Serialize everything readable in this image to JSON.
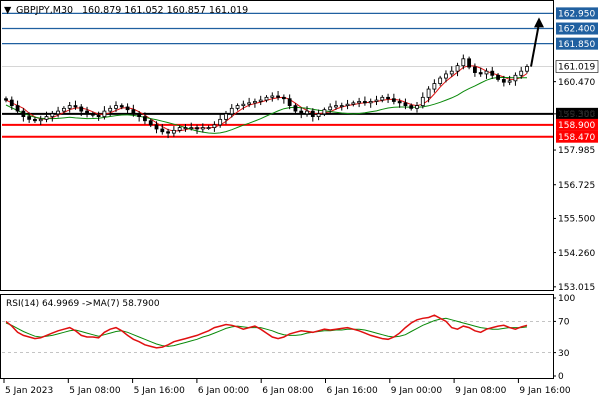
{
  "header": {
    "symbol_tf": "GBPJPY,M30",
    "ohlc": "160.879 161.052 160.857 161.019"
  },
  "rsi_header": "RSI(14) 64.9969  ->MA(7) 58.7900",
  "colors": {
    "candle": "#000000",
    "ma_red": "#e01010",
    "ma_green": "#0a8a0a",
    "level_blue": "#2060a0",
    "level_black": "#000000",
    "level_red": "#ff0000",
    "rsi_line": "#e01010",
    "rsi_ma": "#0a8a0a",
    "arrow": "#000000"
  },
  "chart_data": [
    {
      "type": "candlestick",
      "title": "GBPJPY,M30",
      "y_range": [
        152.9,
        163.4
      ],
      "y_ticks": [
        "160.470",
        "159.300",
        "157.985",
        "156.725",
        "155.500",
        "154.260",
        "153.015"
      ],
      "x_ticks": [
        "5 Jan 2023",
        "5 Jan 08:00",
        "5 Jan 16:00",
        "6 Jan 00:00",
        "6 Jan 08:00",
        "6 Jan 16:00",
        "9 Jan 00:00",
        "9 Jan 08:00",
        "9 Jan 16:00"
      ],
      "current_price": "161.019",
      "levels": [
        {
          "label": "162.950",
          "value": 162.95,
          "color": "blue"
        },
        {
          "label": "162.400",
          "value": 162.4,
          "color": "blue"
        },
        {
          "label": "161.850",
          "value": 161.85,
          "color": "blue"
        },
        {
          "label": "159.300",
          "value": 159.3,
          "color": "black"
        },
        {
          "label": "158.900",
          "value": 158.9,
          "color": "red"
        },
        {
          "label": "158.470",
          "value": 158.47,
          "color": "red"
        }
      ],
      "close_series": [
        159.8,
        159.6,
        159.4,
        159.2,
        159.1,
        159.05,
        159.1,
        159.2,
        159.3,
        159.4,
        159.5,
        159.6,
        159.55,
        159.4,
        159.3,
        159.25,
        159.2,
        159.4,
        159.5,
        159.6,
        159.55,
        159.45,
        159.3,
        159.2,
        159.05,
        158.9,
        158.75,
        158.65,
        158.6,
        158.7,
        158.8,
        158.8,
        158.8,
        158.75,
        158.8,
        158.8,
        158.9,
        159.1,
        159.3,
        159.5,
        159.6,
        159.65,
        159.7,
        159.75,
        159.8,
        159.9,
        159.95,
        159.9,
        159.85,
        159.6,
        159.4,
        159.3,
        159.4,
        159.2,
        159.3,
        159.45,
        159.55,
        159.6,
        159.6,
        159.65,
        159.7,
        159.75,
        159.7,
        159.75,
        159.8,
        159.9,
        159.85,
        159.75,
        159.7,
        159.6,
        159.5,
        159.6,
        159.9,
        160.2,
        160.4,
        160.6,
        160.75,
        160.85,
        161.05,
        161.3,
        161.0,
        160.8,
        160.75,
        160.85,
        160.7,
        160.55,
        160.45,
        160.5,
        160.7,
        160.85,
        161.02
      ],
      "arrow": {
        "from": 161.02,
        "to": 162.95
      }
    },
    {
      "type": "line",
      "title": "RSI(14) 64.9969  ->MA(7) 58.7900",
      "y_range": [
        0,
        100
      ],
      "y_ticks": [
        "100",
        "70",
        "30",
        "0"
      ],
      "series": [
        {
          "name": "RSI(14)",
          "values": [
            70,
            64,
            56,
            52,
            50,
            48,
            49,
            52,
            55,
            58,
            60,
            62,
            58,
            52,
            50,
            50,
            49,
            56,
            60,
            62,
            58,
            52,
            47,
            44,
            40,
            38,
            36,
            37,
            40,
            44,
            46,
            48,
            50,
            52,
            55,
            58,
            62,
            64,
            66,
            65,
            63,
            60,
            62,
            64,
            60,
            55,
            50,
            48,
            50,
            54,
            56,
            58,
            57,
            56,
            58,
            60,
            59,
            60,
            61,
            62,
            60,
            58,
            55,
            52,
            50,
            48,
            47,
            50,
            55,
            62,
            68,
            72,
            74,
            75,
            78,
            74,
            70,
            62,
            60,
            64,
            62,
            58,
            56,
            60,
            62,
            64,
            65,
            62,
            60,
            63,
            65
          ]
        },
        {
          "name": "MA(7)",
          "values": [
            68,
            65,
            61,
            57,
            54,
            51,
            50,
            51,
            52,
            54,
            56,
            58,
            59,
            57,
            55,
            53,
            51,
            53,
            55,
            57,
            58,
            56,
            53,
            50,
            47,
            44,
            41,
            39,
            38,
            39,
            41,
            43,
            45,
            47,
            50,
            52,
            55,
            58,
            61,
            63,
            64,
            63,
            62,
            62,
            62,
            60,
            58,
            55,
            53,
            52,
            52,
            53,
            55,
            56,
            57,
            58,
            58,
            59,
            59,
            60,
            60,
            60,
            59,
            57,
            55,
            53,
            51,
            50,
            51,
            53,
            57,
            61,
            65,
            68,
            71,
            73,
            74,
            72,
            70,
            68,
            66,
            64,
            62,
            61,
            60,
            60,
            61,
            62,
            62,
            62,
            63
          ]
        }
      ]
    }
  ]
}
